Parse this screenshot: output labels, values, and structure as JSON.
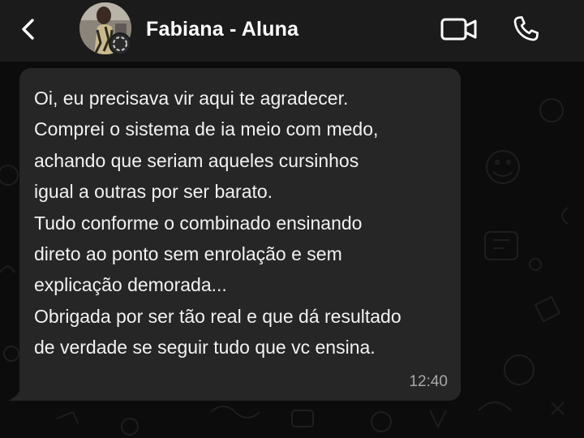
{
  "header": {
    "contact_name": "Fabiana - Aluna",
    "icons": {
      "back": "chevron-left-icon",
      "video": "video-camera-icon",
      "call": "phone-icon",
      "status": "status-ring-icon"
    }
  },
  "message": {
    "text": "Oi, eu precisava vir aqui te agradecer.\nComprei o sistema de ia meio com medo,\nachando que seriam aqueles cursinhos\nigual a outras por ser barato.\nTudo conforme o combinado ensinando\ndireto ao ponto sem enrolação e sem\nexplicação demorada...\nObrigada por ser tão real e que dá resultado\nde verdade se seguir tudo que vc ensina.",
    "time": "12:40"
  },
  "colors": {
    "header_bg": "#1b1b1b",
    "chat_bg": "#0c0c0c",
    "bubble_bg": "#262626",
    "text": "#f2f2f2",
    "timestamp": "#a8a8a8"
  }
}
